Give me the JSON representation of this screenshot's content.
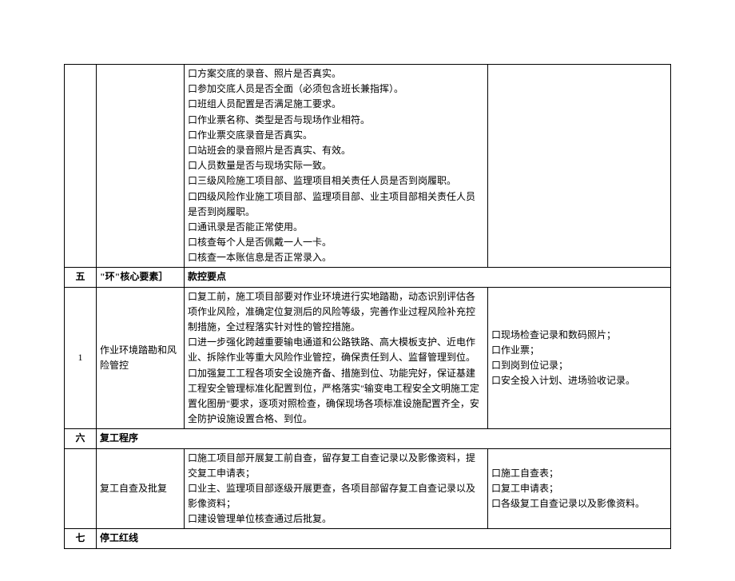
{
  "rows": {
    "prev": {
      "items": [
        "方案交底的录音、照片是否真实。",
        "参加交底人员是否全面（必须包含班长兼指挥）。",
        "班组人员配置是否满足施工要求。",
        "作业票名称、类型是否与现场作业相符。",
        "作业票交底录音是否真实。",
        "站班会的录音照片是否真实、有效。",
        "人员数量是否与现场实际一致。",
        "三级风险施工项目部、监理项目相关责任人员是否到岗履职。",
        "四级风险作业施工项目部、监理项目部、业主项目部相关责任人员是否到岗履职。",
        "通讯录是否能正常使用。",
        "核查每个人是否佩戴一人一卡。",
        "核查一本账信息是否正常录入。"
      ]
    },
    "section5": {
      "num": "五",
      "name": "\"环\"核心要素］",
      "title": "款控要点"
    },
    "env": {
      "num": "1",
      "name": "作业环境踏勘和风险管控",
      "items": [
        "复工前，施工项目部要对作业环境进行实地踏勘，动态识别评估各项作业风险，准确定位复测后的风险等级，完善作业过程风险补充控制措施，全过程落实针对性的管控措施。",
        "进一步强化跨越重要输电通道和公路铁路、高大模板支护、近电作业、拆除作业等重大风险作业管控，确保责任到人、监督管理到位。",
        "加强复工工程各项安全设施齐备、措施到位、功能完好，保证基建工程安全管理标准化配置到位，严格落实\"输变电工程安全文明施工定置化图册\"要求，逐项对照检查，确保现场各项标准设施配置齐全，安全防护设施设置合格、到位。"
      ],
      "remarks": [
        "现场检查记录和数码照片；",
        "作业票；",
        "到岗到位记录；",
        "安全投入计划、进场验收记录。"
      ]
    },
    "section6": {
      "num": "六",
      "name": "复工程序"
    },
    "resume": {
      "num": "",
      "name": "复工自查及批复",
      "items": [
        "施工项目部开展复工前自查，留存复工自查记录以及影像资料，提交复工申请表；",
        "业主、监理项目部逐级开展更查，各项目部留存复工自查记录以及影像资料；",
        "建设管理单位核查通过后批复。"
      ],
      "remarks": [
        "施工自查表；",
        "复工申请表；",
        "各级复工自查记录以及影像资料。"
      ]
    },
    "section7": {
      "num": "七",
      "name": "停工红线"
    }
  }
}
